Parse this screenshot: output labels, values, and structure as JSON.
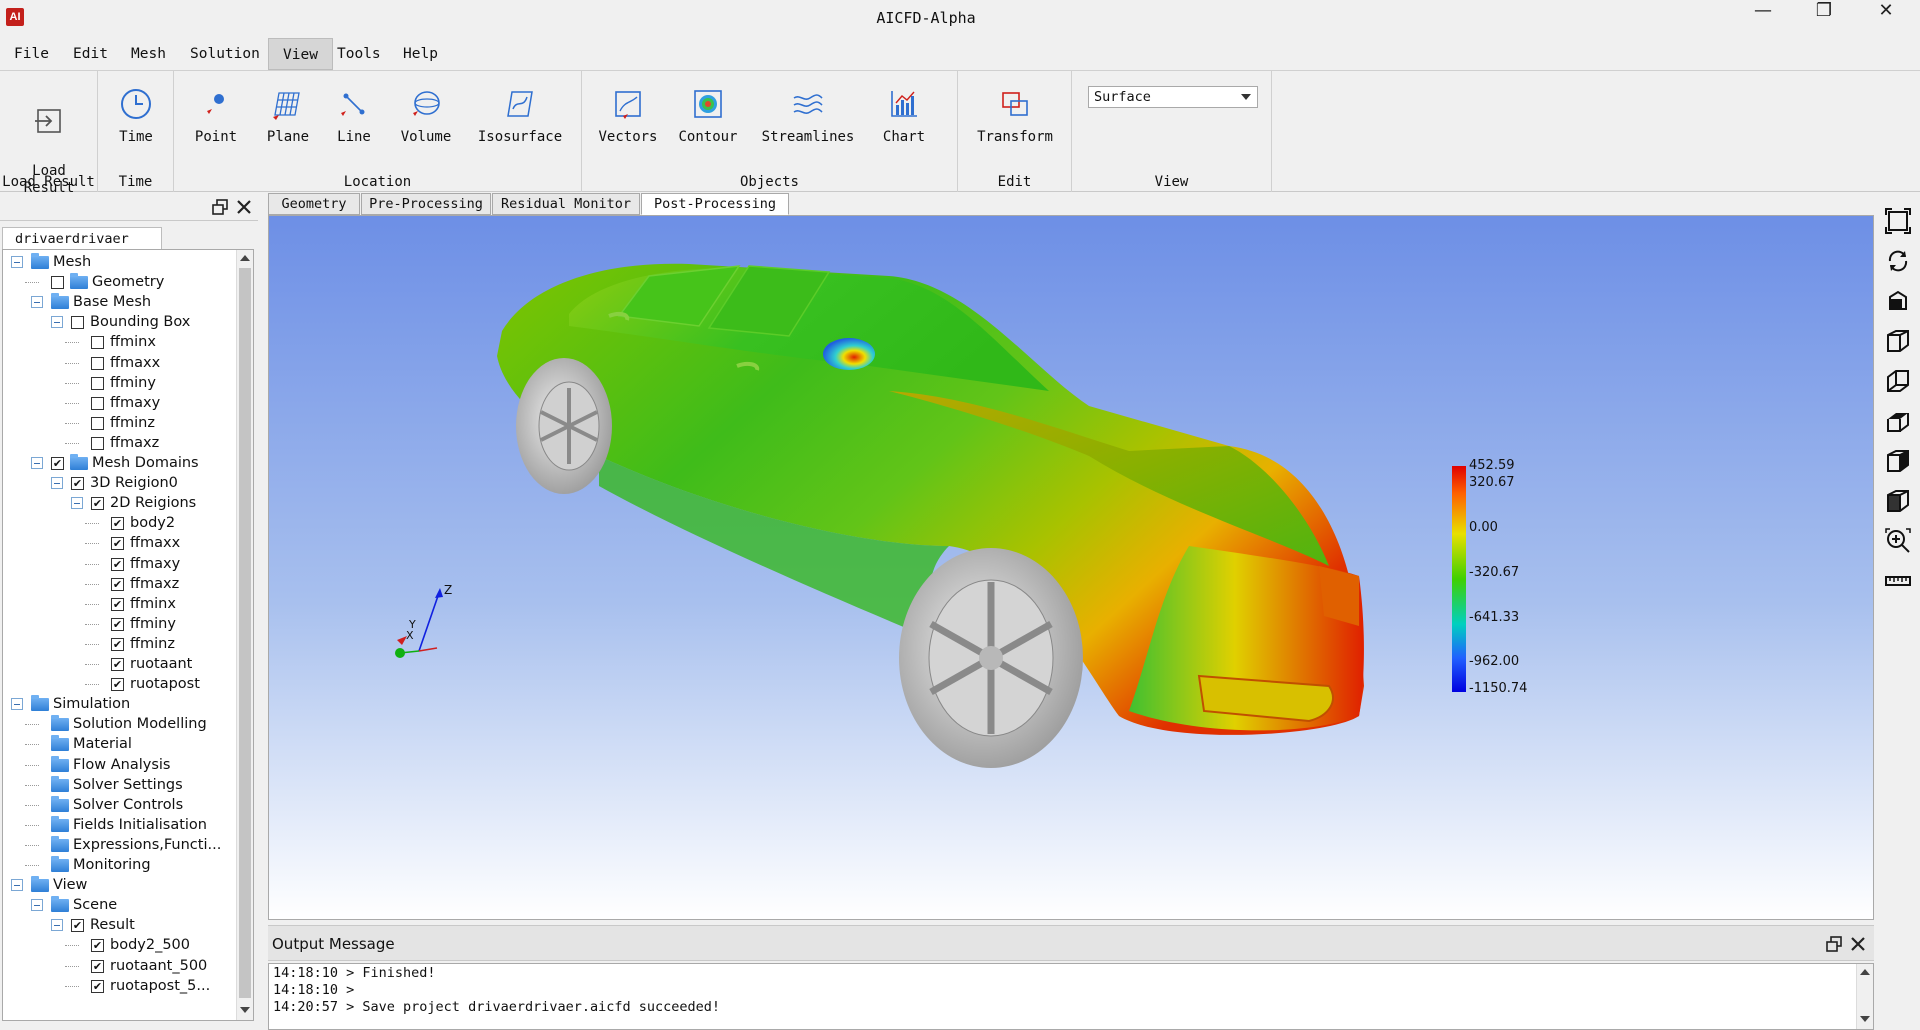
{
  "window": {
    "title": "AICFD-Alpha"
  },
  "menubar": {
    "items": [
      "File",
      "Edit",
      "Mesh",
      "Solution",
      "View",
      "Tools",
      "Help"
    ],
    "active": "View"
  },
  "ribbon": {
    "groups": [
      {
        "label": "Load Result",
        "buttons": [
          "Load\nResult"
        ]
      },
      {
        "label": "Time",
        "buttons": [
          "Time"
        ]
      },
      {
        "label": "Location",
        "buttons": [
          "Point",
          "Plane",
          "Line",
          "Volume",
          "Isosurface"
        ]
      },
      {
        "label": "Objects",
        "buttons": [
          "Vectors",
          "Contour",
          "Streamlines",
          "Chart"
        ]
      },
      {
        "label": "Edit",
        "buttons": [
          "Transform"
        ]
      },
      {
        "label": "View",
        "dropdown": "Surface"
      }
    ]
  },
  "left_panel": {
    "tab": "drivaerdrivaer"
  },
  "tree": [
    {
      "label": "Mesh",
      "level": 0,
      "expander": true,
      "checkbox": null,
      "folder": true
    },
    {
      "label": "Geometry",
      "level": 1,
      "expander": false,
      "checkbox": false,
      "folder": true
    },
    {
      "label": "Base Mesh",
      "level": 1,
      "expander": true,
      "checkbox": null,
      "folder": true
    },
    {
      "label": "Bounding Box",
      "level": 2,
      "expander": true,
      "checkbox": false,
      "folder": false
    },
    {
      "label": "ffminx",
      "level": 3,
      "checkbox": false
    },
    {
      "label": "ffmaxx",
      "level": 3,
      "checkbox": false
    },
    {
      "label": "ffminy",
      "level": 3,
      "checkbox": false
    },
    {
      "label": "ffmaxy",
      "level": 3,
      "checkbox": false
    },
    {
      "label": "ffminz",
      "level": 3,
      "checkbox": false
    },
    {
      "label": "ffmaxz",
      "level": 3,
      "checkbox": false
    },
    {
      "label": "Mesh Domains",
      "level": 1,
      "expander": true,
      "checkbox": true,
      "folder": true
    },
    {
      "label": "3D Reigion0",
      "level": 2,
      "expander": true,
      "checkbox": true
    },
    {
      "label": "2D Reigions",
      "level": 3,
      "expander": true,
      "checkbox": true
    },
    {
      "label": "body2",
      "level": 4,
      "checkbox": true
    },
    {
      "label": "ffmaxx",
      "level": 4,
      "checkbox": true
    },
    {
      "label": "ffmaxy",
      "level": 4,
      "checkbox": true
    },
    {
      "label": "ffmaxz",
      "level": 4,
      "checkbox": true
    },
    {
      "label": "ffminx",
      "level": 4,
      "checkbox": true
    },
    {
      "label": "ffminy",
      "level": 4,
      "checkbox": true
    },
    {
      "label": "ffminz",
      "level": 4,
      "checkbox": true
    },
    {
      "label": "ruotaant",
      "level": 4,
      "checkbox": true
    },
    {
      "label": "ruotapost",
      "level": 4,
      "checkbox": true
    },
    {
      "label": "Simulation",
      "level": 0,
      "expander": true,
      "folder": true
    },
    {
      "label": "Solution Modelling",
      "level": 1,
      "folder": true
    },
    {
      "label": "Material",
      "level": 1,
      "folder": true
    },
    {
      "label": "Flow Analysis",
      "level": 1,
      "folder": true
    },
    {
      "label": "Solver Settings",
      "level": 1,
      "folder": true
    },
    {
      "label": "Solver Controls",
      "level": 1,
      "folder": true
    },
    {
      "label": "Fields Initialisation",
      "level": 1,
      "folder": true
    },
    {
      "label": "Expressions,Functi...",
      "level": 1,
      "folder": true
    },
    {
      "label": "Monitoring",
      "level": 1,
      "folder": true
    },
    {
      "label": "View",
      "level": 0,
      "expander": true,
      "folder": true
    },
    {
      "label": "Scene",
      "level": 1,
      "expander": true,
      "folder": true
    },
    {
      "label": "Result",
      "level": 2,
      "expander": true,
      "checkbox": true
    },
    {
      "label": "body2_500",
      "level": 3,
      "checkbox": true
    },
    {
      "label": "ruotaant_500",
      "level": 3,
      "checkbox": true
    },
    {
      "label": "ruotapost_5...",
      "level": 3,
      "checkbox": true
    }
  ],
  "view_tabs": {
    "items": [
      "Geometry",
      "Pre-Processing",
      "Residual Monitor",
      "Post-Processing"
    ],
    "active": "Post-Processing"
  },
  "axes": {
    "z": "Z",
    "y": "Y",
    "x": "X"
  },
  "colorbar": {
    "labels": [
      "452.59",
      "320.67",
      "0.00",
      "-320.67",
      "-641.33",
      "-962.00",
      "-1150.74"
    ]
  },
  "output": {
    "title": "Output Message",
    "lines": [
      "14:18:10 > Finished!",
      "14:18:10 >",
      "14:20:57 > Save project drivaerdrivaer.aicfd succeeded!"
    ]
  },
  "colors": {
    "ribbon_icon": "#2f6fd0",
    "accent_red": "#d0201b"
  }
}
